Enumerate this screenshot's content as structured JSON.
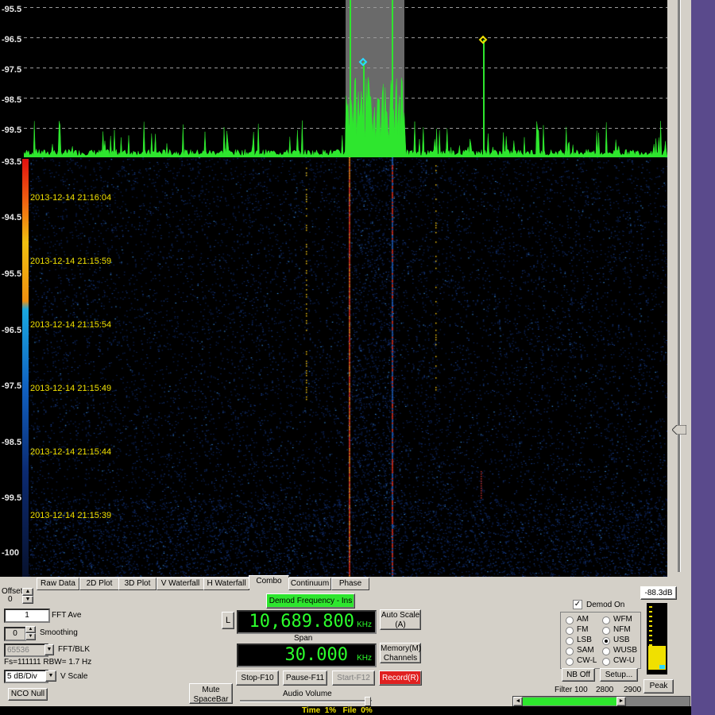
{
  "spectrum_axis": [
    "-95.5",
    "-96.5",
    "-97.5",
    "-98.5",
    "-99.5"
  ],
  "waterfall_axis": [
    "-93.5",
    "-94.5",
    "-95.5",
    "-96.5",
    "-97.5",
    "-98.5",
    "-99.5",
    "-100"
  ],
  "timestamps": [
    "2013-12-14 21:16:04",
    "2013-12-14 21:15:59",
    "2013-12-14 21:15:54",
    "2013-12-14 21:15:49",
    "2013-12-14 21:15:44",
    "2013-12-14 21:15:39"
  ],
  "colors": {
    "trace": "#2ee62e",
    "marker1": "#2ad8ff",
    "marker2": "#f0e000",
    "window_bg": "#d4d0c8",
    "record": "#e02020",
    "status_bar": "#f0e000"
  },
  "tabs": [
    "Raw Data",
    "2D Plot",
    "3D Plot",
    "V Waterfall",
    "H Waterfall",
    "Combo",
    "Continuum",
    "Phase"
  ],
  "active_tab": "Combo",
  "offset": {
    "label": "Offset",
    "value": "0"
  },
  "fft_ave": {
    "value": "1",
    "label": "FFT Ave"
  },
  "smoothing": {
    "value": "0",
    "label": "Smoothing"
  },
  "fft_blk": {
    "value": "65536",
    "label": "FFT/BLK"
  },
  "fs_info": "Fs=111111 RBW= 1.7 Hz",
  "vscale": {
    "value": "5 dB/Div",
    "label": "V Scale"
  },
  "nco_null": "NCO Null",
  "mute": "Mute SpaceBar",
  "demod_freq_button": "Demod Frequency - Ins",
  "l_button": "L",
  "frequency": {
    "value": "10,689.800",
    "unit": "KHz"
  },
  "span": {
    "label": "Span",
    "value": "30.000",
    "unit": "KHz"
  },
  "auto_scale": "Auto Scale (A)",
  "memory": "Memory(M) Channels",
  "stop": "Stop-F10",
  "pause": "Pause-F11",
  "start": "Start-F12",
  "record": "Record(R)",
  "audio_volume": {
    "label": "Audio Volume",
    "level": 0.98
  },
  "demod_on": {
    "label": "Demod On",
    "checked": true
  },
  "modes": [
    {
      "label": "AM",
      "on": false
    },
    {
      "label": "WFM",
      "on": false
    },
    {
      "label": "FM",
      "on": false
    },
    {
      "label": "NFM",
      "on": false
    },
    {
      "label": "LSB",
      "on": false
    },
    {
      "label": "USB",
      "on": true
    },
    {
      "label": "SAM",
      "on": false
    },
    {
      "label": "WUSB",
      "on": false
    },
    {
      "label": "CW-L",
      "on": false
    },
    {
      "label": "CW-U",
      "on": false
    }
  ],
  "nb_off": "NB Off",
  "setup": "Setup...",
  "signal_level": "-88.3dB",
  "peak": "Peak",
  "filter": {
    "label": "Filter",
    "low": "100",
    "center": "2800",
    "high": "2900"
  },
  "status": "Time  1%   File  0%",
  "scroll_arrows": {
    "left": "◄",
    "right": "►"
  }
}
